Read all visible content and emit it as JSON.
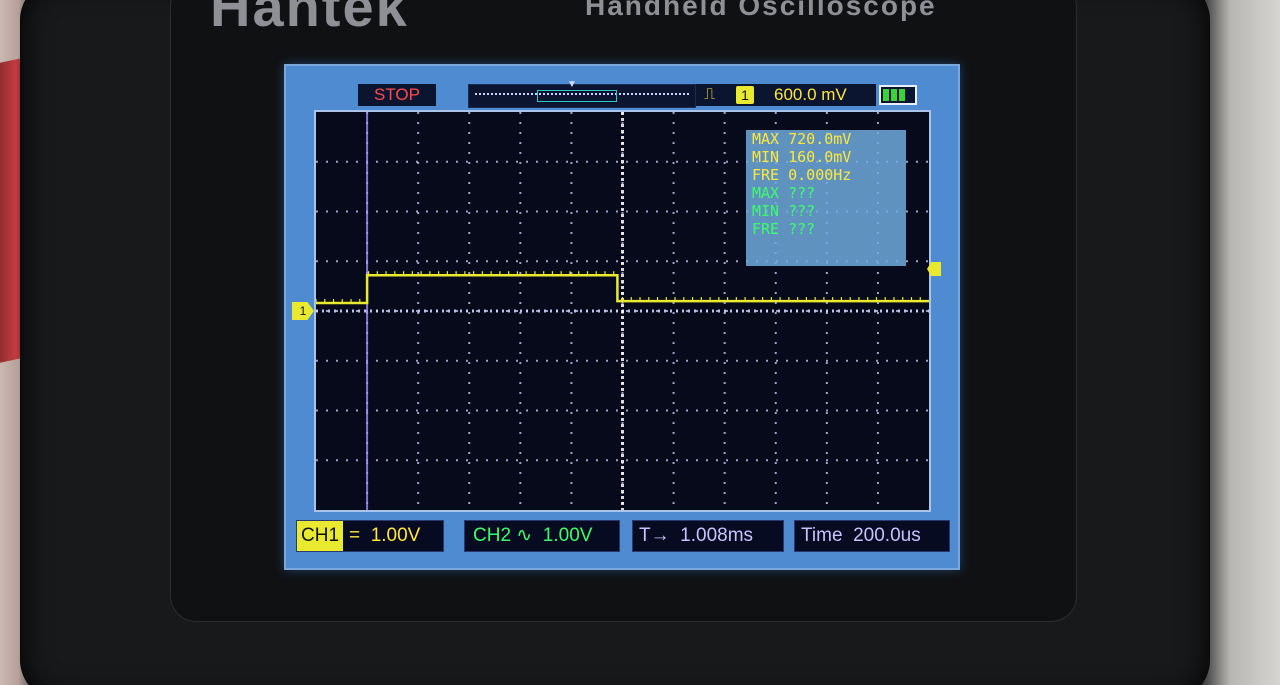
{
  "device": {
    "brand": "Hantek",
    "model_text": "Handheld Oscilloscope"
  },
  "status": {
    "run_state": "STOP",
    "trigger_channel": "1",
    "trigger_level": "600.0 mV",
    "battery_bars": 3
  },
  "measurements": {
    "ch1": [
      {
        "label": "MAX",
        "value": "720.0mV"
      },
      {
        "label": "MIN",
        "value": "160.0mV"
      },
      {
        "label": "FRE",
        "value": "0.000Hz"
      }
    ],
    "ch2": [
      {
        "label": "MAX",
        "value": "???"
      },
      {
        "label": "MIN",
        "value": "???"
      },
      {
        "label": "FRE",
        "value": "???"
      }
    ]
  },
  "channel_marker": "1",
  "bottom": {
    "ch1_label": "CH1",
    "ch1_coupling": "=",
    "ch1_scale": "1.00V",
    "ch2_label": "CH2",
    "ch2_coupling": "∿",
    "ch2_scale": "1.00V",
    "trigger_pos_label": "T→",
    "trigger_pos_value": "1.008ms",
    "time_label": "Time",
    "time_value": "200.0us"
  },
  "colors": {
    "ch1": "#e9ea30",
    "ch2": "#3bff6a",
    "grid": "#cfd6ff",
    "cursor": "#a98cff"
  },
  "chart_data": {
    "type": "line",
    "title": "",
    "xlabel": "",
    "ylabel": "",
    "x_divisions": 12,
    "y_divisions": 8,
    "series": [
      {
        "x": [
          0.0,
          1.0,
          1.0,
          5.9,
          5.9,
          12.0
        ],
        "y": [
          0.16,
          0.16,
          0.72,
          0.72,
          0.2,
          0.2
        ]
      }
    ],
    "volts_per_div": 1.0,
    "ground_division_from_top": 4.0
  }
}
